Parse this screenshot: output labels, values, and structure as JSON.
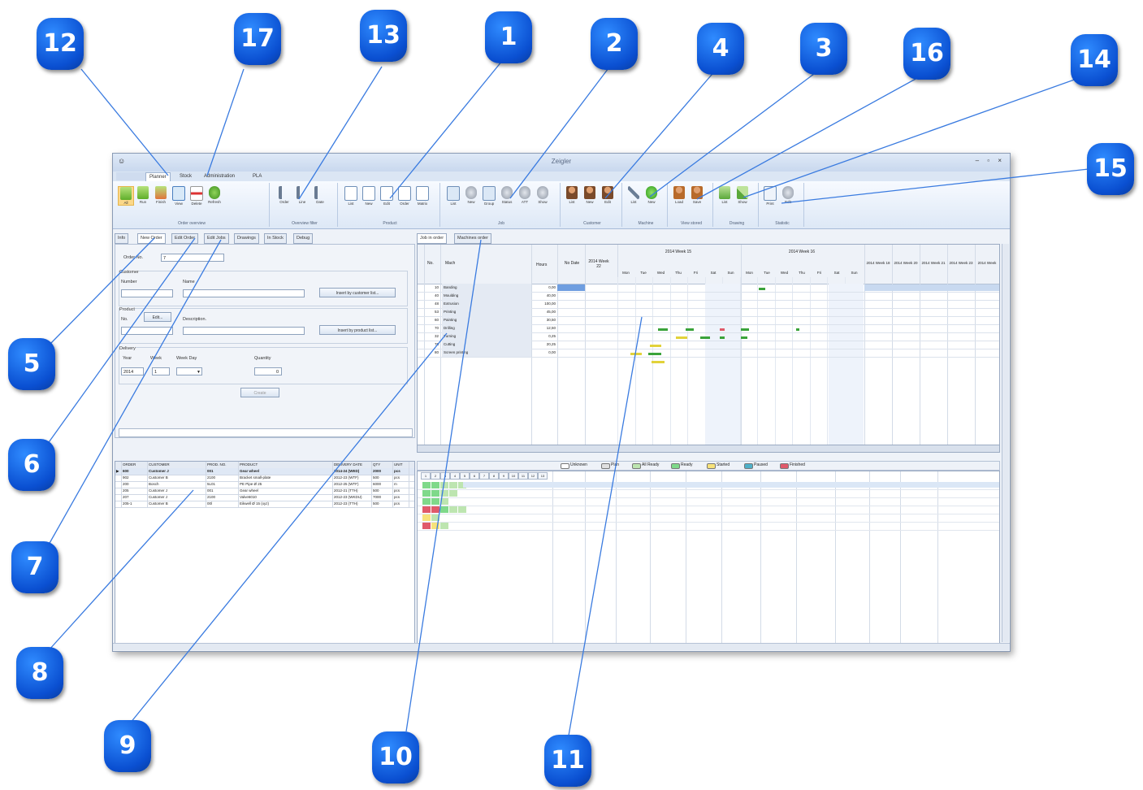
{
  "window": {
    "title": "Zeigler",
    "menu_tabs": [
      "",
      "Planner",
      "Stock",
      "Administration",
      "PLA"
    ]
  },
  "ribbon": {
    "groups": [
      {
        "label": "Order overview",
        "buttons": [
          "All",
          "Run",
          "Finish",
          "View",
          "Delete",
          "Refresh"
        ]
      },
      {
        "label": "Overview filter",
        "buttons": [
          "Order",
          "Line",
          "Date"
        ]
      },
      {
        "label": "Product",
        "buttons": [
          "List",
          "New",
          "Edit",
          "Order",
          "Matrix"
        ]
      },
      {
        "label": "Job",
        "buttons": [
          "List",
          "New",
          "Group",
          "Status",
          "ATT",
          "Show"
        ]
      },
      {
        "label": "Customer",
        "buttons": [
          "List",
          "New",
          "Edit"
        ]
      },
      {
        "label": "Machine",
        "buttons": [
          "List",
          "New"
        ]
      },
      {
        "label": "View stored",
        "buttons": [
          "Load",
          "Save"
        ]
      },
      {
        "label": "Drawing",
        "buttons": [
          "List",
          "Show"
        ]
      },
      {
        "label": "Statistic",
        "buttons": [
          "Print",
          "Edit"
        ]
      }
    ]
  },
  "left_tabs": [
    "Info",
    "New Order",
    "Edit Order",
    "Edit Jobs",
    "Drawings",
    "In Stock",
    "Debug"
  ],
  "order_form": {
    "order_no_label": "Order No.",
    "order_no_value": "7",
    "customer_label": "Customer",
    "number_label": "Number",
    "name_label": "Name",
    "insert_customer_button": "Insert by customer list...",
    "product_label": "Product",
    "no_label": "No.",
    "edit_button": "Edit...",
    "description_label": "Description.",
    "insert_product_button": "Insert by product list...",
    "delivery_label": "Delivery",
    "year_label": "Year",
    "year_value": "2014",
    "week_label": "Week",
    "week_value": "1",
    "weekday_label": "Week Day",
    "quantity_label": "Quantity",
    "quantity_value": "0",
    "create_button": "Create"
  },
  "order_table": {
    "headers": [
      "ORDER",
      "CUSTOMER",
      "PROD. NO.",
      "PRODUCT",
      "DELIVERY DATE",
      "QTY",
      "UNIT"
    ],
    "rows": [
      [
        "600",
        "Customer J",
        "001",
        "Gear wheel",
        "2014-24 (WED)",
        "2000",
        "pcs"
      ],
      [
        "902",
        "Customer B",
        "2100",
        "Bracket small-plate",
        "2012-23 (WTF)",
        "500",
        "pcs"
      ],
      [
        "200",
        "Bosch",
        "5L01",
        "PE Pipe Ø 25",
        "2012-25 (WTF)",
        "6000",
        "m"
      ],
      [
        "205",
        "Customer J",
        "001",
        "Gear wheel",
        "2012-21 (TTH)",
        "500",
        "pcs"
      ],
      [
        "207",
        "Customer J",
        "2100",
        "Valve6010",
        "2012-23 (WKDU)",
        "7000",
        "pcs"
      ],
      [
        "205-1",
        "Customer B",
        "00l",
        "Eikwell Ø 15 (xyz)",
        "2012-23 (TTH)",
        "500",
        "pcs"
      ]
    ]
  },
  "right_tabs": [
    "Job in order",
    "Machines order"
  ],
  "gantt": {
    "headers": {
      "no": "No.",
      "mach": "Mach",
      "hours": "Hours",
      "no_date": "No Date",
      "prev_week": "2014 Week 22"
    },
    "weeks": [
      "2014 Week 15",
      "2014 Week 16"
    ],
    "days": [
      "Mon",
      "Tue",
      "Wed",
      "Thu",
      "Fri",
      "Sat",
      "Sun"
    ],
    "later_weeks": [
      "2014 Week 18",
      "2014 Week 20",
      "2014 Week 21",
      "2014 Week 23",
      "2014 Week"
    ],
    "machines": [
      {
        "no": "10",
        "name": "Banding",
        "hours": "0,00"
      },
      {
        "no": "40",
        "name": "Moulding",
        "hours": "40,00"
      },
      {
        "no": "48",
        "name": "Extrusion",
        "hours": "100,00"
      },
      {
        "no": "53",
        "name": "Printing",
        "hours": "45,00"
      },
      {
        "no": "60",
        "name": "Painting",
        "hours": "30,50"
      },
      {
        "no": "70",
        "name": "Drilling",
        "hours": "12,50"
      },
      {
        "no": "32",
        "name": "Turning",
        "hours": "0,25"
      },
      {
        "no": "76",
        "name": "Cutting",
        "hours": "20,25"
      },
      {
        "no": "80",
        "name": "Screen printing",
        "hours": "0,00"
      }
    ],
    "legend": [
      "Unknown",
      "Plan",
      "All Ready",
      "Ready",
      "Started",
      "Paused",
      "Finished"
    ],
    "legend_colors": [
      "#ffffff",
      "#e0e0e0",
      "#bde5b0",
      "#7fd98a",
      "#f7e27a",
      "#4fb0c8",
      "#e05a6a"
    ]
  },
  "callouts": [
    "12",
    "17",
    "13",
    "1",
    "2",
    "4",
    "3",
    "16",
    "14",
    "15",
    "5",
    "6",
    "7",
    "8",
    "9",
    "10",
    "11"
  ]
}
